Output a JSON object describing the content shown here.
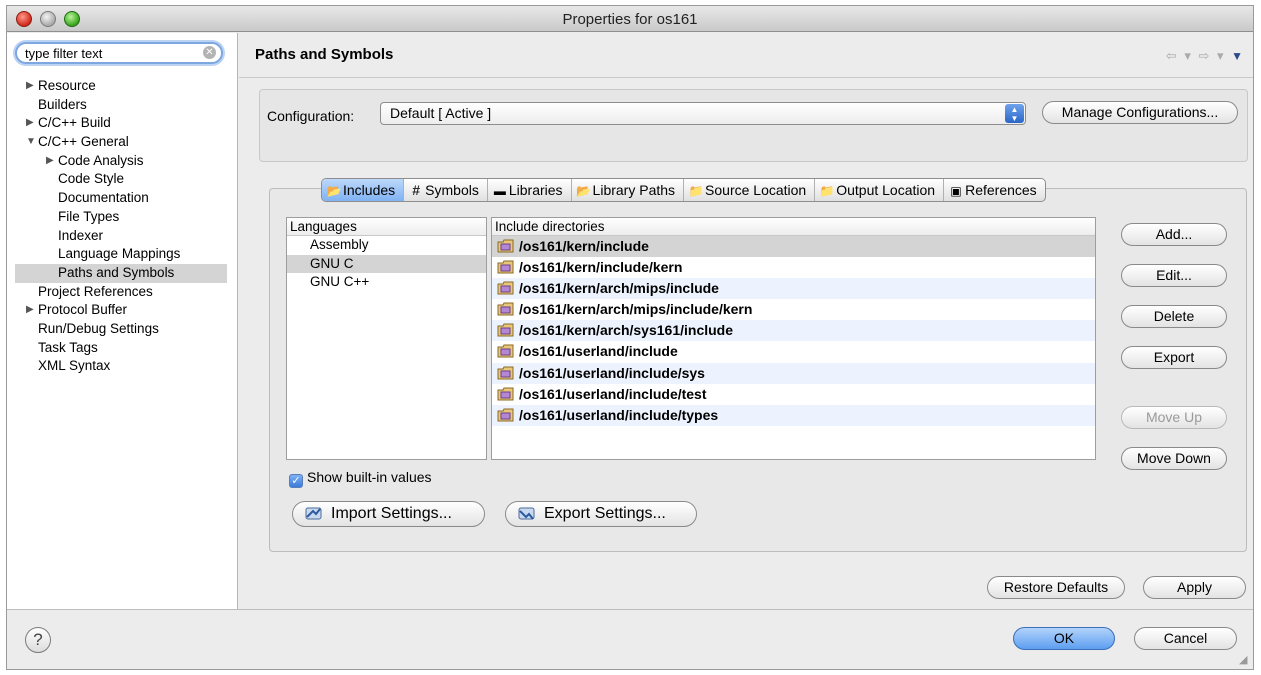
{
  "window": {
    "title": "Properties for os161"
  },
  "filter": {
    "placeholder": "type filter text",
    "value": "type filter text"
  },
  "tree": [
    {
      "label": "Resource",
      "twisty": "▶"
    },
    {
      "label": "Builders"
    },
    {
      "label": "C/C++ Build",
      "twisty": "▶"
    },
    {
      "label": "C/C++ General",
      "twisty": "▼"
    },
    {
      "label": "Code Analysis",
      "twisty": "▶"
    },
    {
      "label": "Code Style"
    },
    {
      "label": "Documentation"
    },
    {
      "label": "File Types"
    },
    {
      "label": "Indexer"
    },
    {
      "label": "Language Mappings"
    },
    {
      "label": "Paths and Symbols"
    },
    {
      "label": "Project References"
    },
    {
      "label": "Protocol Buffer",
      "twisty": "▶"
    },
    {
      "label": "Run/Debug Settings"
    },
    {
      "label": "Task Tags"
    },
    {
      "label": "XML Syntax"
    }
  ],
  "page": {
    "title": "Paths and Symbols",
    "nav": "⇦ ▾ ⇨ ▾",
    "menu": "▼"
  },
  "config": {
    "label": "Configuration:",
    "value": "Default  [ Active ]",
    "manage_label": "Manage Configurations..."
  },
  "tabs": [
    {
      "label": "Includes",
      "icon": "includes-icon",
      "glyph": "📂"
    },
    {
      "label": "Symbols",
      "icon": "hash-icon",
      "glyph": "#"
    },
    {
      "label": "Libraries",
      "icon": "libraries-icon",
      "glyph": "▬"
    },
    {
      "label": "Library Paths",
      "icon": "library-paths-icon",
      "glyph": "📂"
    },
    {
      "label": "Source Location",
      "icon": "source-folder-icon",
      "glyph": "📁"
    },
    {
      "label": "Output Location",
      "icon": "output-folder-icon",
      "glyph": "📁"
    },
    {
      "label": "References",
      "icon": "references-icon",
      "glyph": "▣"
    }
  ],
  "languages": {
    "header": "Languages",
    "items": [
      "Assembly",
      "GNU C",
      "GNU C++"
    ]
  },
  "includes": {
    "header": "Include directories",
    "items": [
      "/os161/kern/include",
      "/os161/kern/include/kern",
      "/os161/kern/arch/mips/include",
      "/os161/kern/arch/mips/include/kern",
      "/os161/kern/arch/sys161/include",
      "/os161/userland/include",
      "/os161/userland/include/sys",
      "/os161/userland/include/test",
      "/os161/userland/include/types"
    ]
  },
  "side_buttons": {
    "add": "Add...",
    "edit": "Edit...",
    "delete": "Delete",
    "export": "Export",
    "move_up": "Move Up",
    "move_down": "Move Down"
  },
  "show_builtin": {
    "label": "Show built-in values",
    "checked": true
  },
  "import_settings": "Import Settings...",
  "export_settings": "Export Settings...",
  "restore_defaults": "Restore Defaults",
  "apply": "Apply",
  "ok": "OK",
  "cancel": "Cancel",
  "help_glyph": "?"
}
